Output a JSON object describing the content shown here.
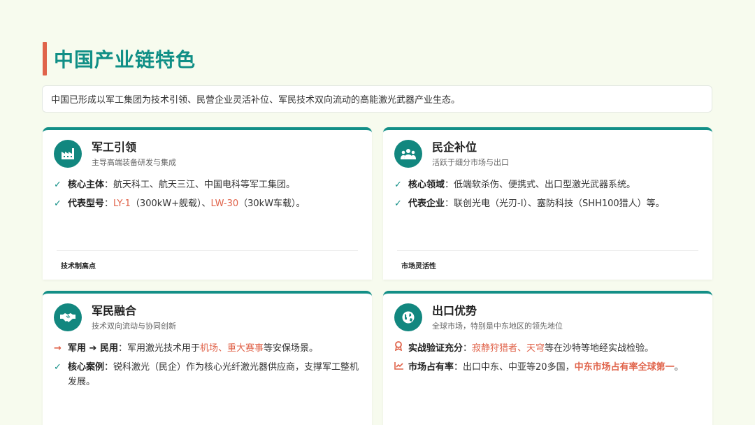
{
  "title": "中国产业链特色",
  "intro": "中国已形成以军工集团为技术引领、民营企业灵活补位、军民技术双向流动的高能激光武器产业生态。",
  "colors": {
    "accent": "#138f87",
    "highlight": "#e0634a",
    "background": "#f7fbee"
  },
  "cards": [
    {
      "icon": "factory-icon",
      "title": "军工引领",
      "subtitle": "主导高端装备研发与集成",
      "items": [
        {
          "key": "核心主体",
          "sep": "：",
          "text": "航天科工、航天三江、中国电科等军工集团。"
        },
        {
          "key": "代表型号",
          "sep": "：",
          "hl1": "LY-1",
          "t1": "（300kW+舰载）、",
          "hl2": "LW-30",
          "t2": "（30kW车载）。"
        }
      ],
      "footer": "技术制高点"
    },
    {
      "icon": "users-icon",
      "title": "民企补位",
      "subtitle": "活跃于细分市场与出口",
      "items": [
        {
          "key": "核心领域",
          "sep": "：",
          "text": "低端软杀伤、便携式、出口型激光武器系统。"
        },
        {
          "key": "代表企业",
          "sep": "：",
          "text": "联创光电（光刃-I）、塞防科技（SHH100猎人）等。"
        }
      ],
      "footer": "市场灵活性"
    },
    {
      "icon": "handshake-icon",
      "title": "军民融合",
      "subtitle": "技术双向流动与协同创新",
      "items": [
        {
          "key": "军用 ➔ 民用",
          "sep": "：",
          "t1": "军用激光技术用于",
          "hl1": "机场、重大赛事",
          "t2": "等安保场景。"
        },
        {
          "key": "核心案例",
          "sep": "：",
          "text": "锐科激光（民企）作为核心光纤激光器供应商，支撑军工整机发展。"
        }
      ]
    },
    {
      "icon": "globe-icon",
      "title": "出口优势",
      "subtitle": "全球市场，特别是中东地区的领先地位",
      "items": [
        {
          "key": "实战验证充分",
          "sep": "：",
          "hl1": "寂静狩猎者、天穹",
          "t2": "等在沙特等地经实战检验。"
        },
        {
          "key": "市场占有率",
          "sep": "：",
          "t1": "出口中东、中亚等20多国，",
          "hl1": "中东市场占有率全球第一",
          "t2": "。"
        }
      ]
    }
  ]
}
